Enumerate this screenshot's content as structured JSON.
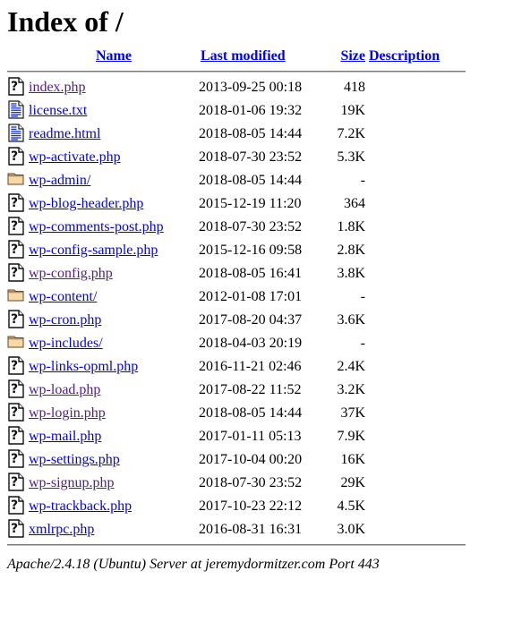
{
  "page": {
    "title": "Index of /",
    "link_color": "#0000EE",
    "visited_link_color": "#551A8B"
  },
  "table": {
    "headers": {
      "icon": "",
      "name": "Name",
      "last_modified": "Last modified",
      "size": "Size",
      "description": "Description"
    },
    "rows": [
      {
        "icon": "unknown-file-icon",
        "name": "index.php",
        "last_modified": "2013-09-25 00:18",
        "size": "418",
        "description": "",
        "visited": true
      },
      {
        "icon": "text-file-icon",
        "name": "license.txt",
        "last_modified": "2018-01-06 19:32",
        "size": "19K",
        "description": "",
        "visited": false
      },
      {
        "icon": "text-file-icon",
        "name": "readme.html",
        "last_modified": "2018-08-05 14:44",
        "size": "7.2K",
        "description": "",
        "visited": false
      },
      {
        "icon": "unknown-file-icon",
        "name": "wp-activate.php",
        "last_modified": "2018-07-30 23:52",
        "size": "5.3K",
        "description": "",
        "visited": false
      },
      {
        "icon": "folder-icon",
        "name": "wp-admin/",
        "last_modified": "2018-08-05 14:44",
        "size": "-",
        "description": "",
        "visited": false
      },
      {
        "icon": "unknown-file-icon",
        "name": "wp-blog-header.php",
        "last_modified": "2015-12-19 11:20",
        "size": "364",
        "description": "",
        "visited": false
      },
      {
        "icon": "unknown-file-icon",
        "name": "wp-comments-post.php",
        "last_modified": "2018-07-30 23:52",
        "size": "1.8K",
        "description": "",
        "visited": false
      },
      {
        "icon": "unknown-file-icon",
        "name": "wp-config-sample.php",
        "last_modified": "2015-12-16 09:58",
        "size": "2.8K",
        "description": "",
        "visited": false
      },
      {
        "icon": "unknown-file-icon",
        "name": "wp-config.php",
        "last_modified": "2018-08-05 16:41",
        "size": "3.8K",
        "description": "",
        "visited": true
      },
      {
        "icon": "folder-icon",
        "name": "wp-content/",
        "last_modified": "2012-01-08 17:01",
        "size": "-",
        "description": "",
        "visited": false
      },
      {
        "icon": "unknown-file-icon",
        "name": "wp-cron.php",
        "last_modified": "2017-08-20 04:37",
        "size": "3.6K",
        "description": "",
        "visited": false
      },
      {
        "icon": "folder-icon",
        "name": "wp-includes/",
        "last_modified": "2018-04-03 20:19",
        "size": "-",
        "description": "",
        "visited": false
      },
      {
        "icon": "unknown-file-icon",
        "name": "wp-links-opml.php",
        "last_modified": "2016-11-21 02:46",
        "size": "2.4K",
        "description": "",
        "visited": false
      },
      {
        "icon": "unknown-file-icon",
        "name": "wp-load.php",
        "last_modified": "2017-08-22 11:52",
        "size": "3.2K",
        "description": "",
        "visited": true
      },
      {
        "icon": "unknown-file-icon",
        "name": "wp-login.php",
        "last_modified": "2018-08-05 14:44",
        "size": "37K",
        "description": "",
        "visited": true
      },
      {
        "icon": "unknown-file-icon",
        "name": "wp-mail.php",
        "last_modified": "2017-01-11 05:13",
        "size": "7.9K",
        "description": "",
        "visited": false
      },
      {
        "icon": "unknown-file-icon",
        "name": "wp-settings.php",
        "last_modified": "2017-10-04 00:20",
        "size": "16K",
        "description": "",
        "visited": false
      },
      {
        "icon": "unknown-file-icon",
        "name": "wp-signup.php",
        "last_modified": "2018-07-30 23:52",
        "size": "29K",
        "description": "",
        "visited": true
      },
      {
        "icon": "unknown-file-icon",
        "name": "wp-trackback.php",
        "last_modified": "2017-10-23 22:12",
        "size": "4.5K",
        "description": "",
        "visited": false
      },
      {
        "icon": "unknown-file-icon",
        "name": "xmlrpc.php",
        "last_modified": "2016-08-31 16:31",
        "size": "3.0K",
        "description": "",
        "visited": false
      }
    ]
  },
  "footer": {
    "server_signature": "Apache/2.4.18 (Ubuntu) Server at jeremydormitzer.com Port 443"
  }
}
